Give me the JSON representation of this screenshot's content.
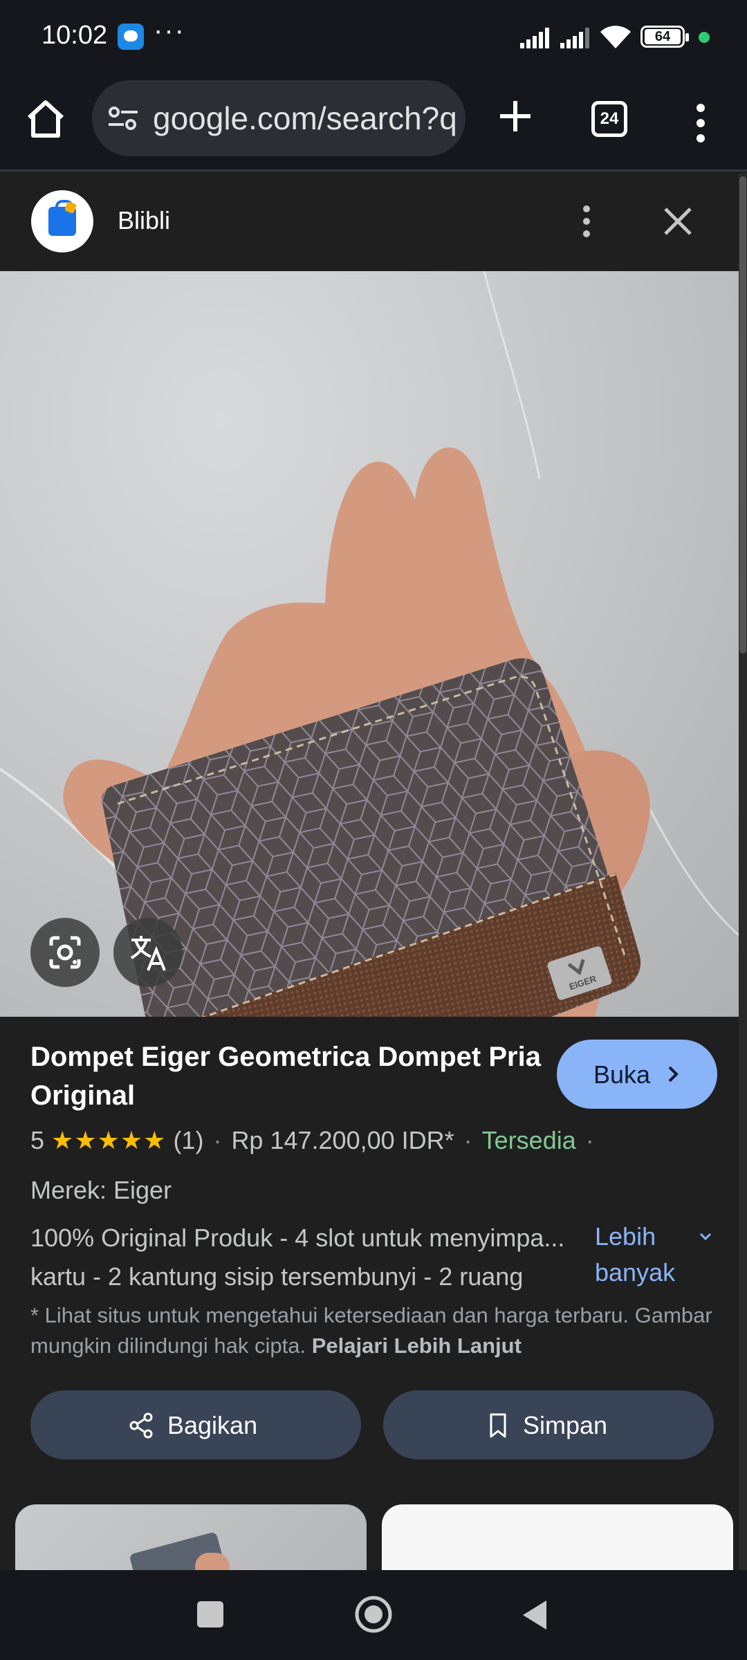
{
  "status_bar": {
    "time": "10:02",
    "dots": "···",
    "battery": "64"
  },
  "browser": {
    "url": "google.com/search?q",
    "tab_count": "24"
  },
  "source": {
    "name": "Blibli"
  },
  "product": {
    "title": "Dompet Eiger Geometrica Dompet Pria Original",
    "open_button": "Buka",
    "rating": "5",
    "stars": "★★★★★",
    "review_count": "(1)",
    "price": "Rp 147.200,00 IDR*",
    "availability": "Tersedia",
    "brand": "Merek: Eiger",
    "description_line1": "100% Original Produk - 4 slot untuk menyimpa...",
    "description_line2": "kartu - 2 kantung sisip tersembunyi - 2 ruang",
    "more_link_line1": "Lebih",
    "more_link_line2": "banyak",
    "disclaimer": "* Lihat situs untuk mengetahui ketersediaan dan harga terbaru. Gambar mungkin dilindungi hak cipta.",
    "learn_more": "Pelajari Lebih Lanjut",
    "share_button": "Bagikan",
    "save_button": "Simpan",
    "wallet_logo_text": "EIGER"
  },
  "colors": {
    "accent": "#8ab4f8",
    "availability": "#81c995",
    "stars": "#fbbc04",
    "background": "#1f1f1f"
  }
}
